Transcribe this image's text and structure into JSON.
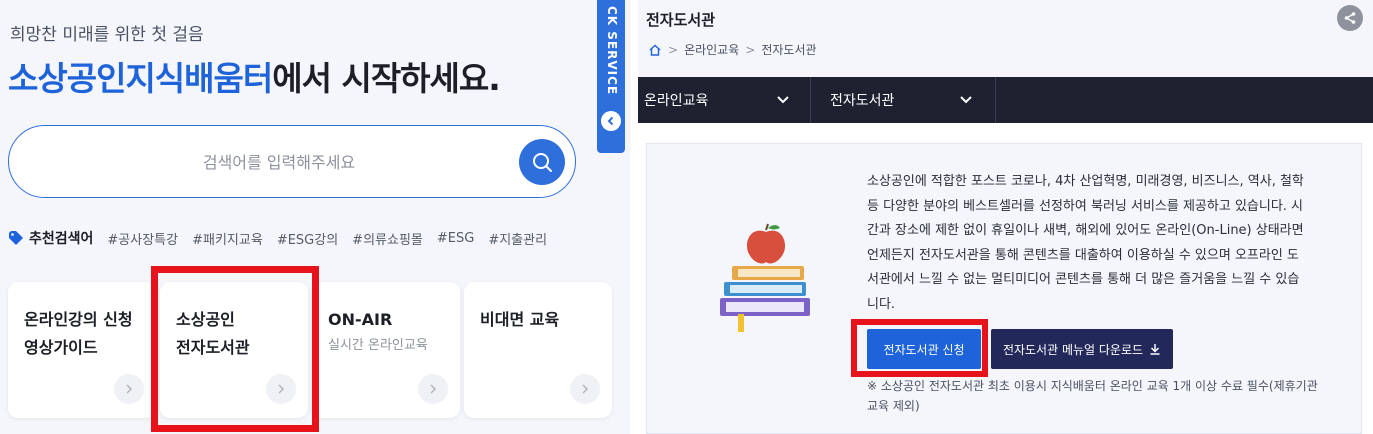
{
  "left": {
    "tagline": "희망찬 미래를 위한 첫 걸음",
    "headline_accent": "소상공인지식배움터",
    "headline_rest": "에서 시작하세요.",
    "search": {
      "placeholder": "검색어를 입력해주세요"
    },
    "recommended": {
      "label": "추천검색어",
      "tags": [
        "#공사장특강",
        "#패키지교육",
        "#ESG강의",
        "#의류쇼핑몰",
        "#ESG",
        "#지출관리"
      ]
    },
    "cards": [
      {
        "title": "온라인강의 신청\n영상가이드",
        "subtitle": ""
      },
      {
        "title": "소상공인\n전자도서관",
        "subtitle": ""
      },
      {
        "title": "ON-AIR",
        "subtitle": "실시간 온라인교육"
      },
      {
        "title": "비대면 교육",
        "subtitle": ""
      }
    ],
    "quick_service": "CK SERVICE"
  },
  "right": {
    "title": "전자도서관",
    "breadcrumb": [
      "온라인교육",
      "전자도서관"
    ],
    "nav": {
      "item1": "온라인교육",
      "item2": "전자도서관"
    },
    "description": "소상공인에 적합한 포스트 코로나, 4차 산업혁명, 미래경영, 비즈니스, 역사, 철학 등 다양한 분야의 베스트셀러를 선정하여 북러닝 서비스를 제공하고 있습니다. 시간과 장소에 제한 없이 휴일이나 새벽, 해외에 있어도 온라인(On-Line) 상태라면 언제든지 전자도서관을 통해 콘텐츠를 대출하여 이용하실 수 있으며 오프라인 도서관에서 느낄 수 없는 멀티미디어 콘텐츠를 통해 더 많은 즐거움을 느낄 수 있습니다.",
    "apply_button": "전자도서관 신청",
    "manual_button": "전자도서관 메뉴얼 다운로드",
    "note": "※ 소상공인 전자도서관 최초 이용시 지식배움터 온라인 교육 1개 이상 수료 필수(제휴기관 교육 제외)"
  },
  "colors": {
    "accent": "#1e63d9",
    "highlight": "#e8121b",
    "navbar": "#1e2130",
    "manual_button": "#22295a"
  }
}
